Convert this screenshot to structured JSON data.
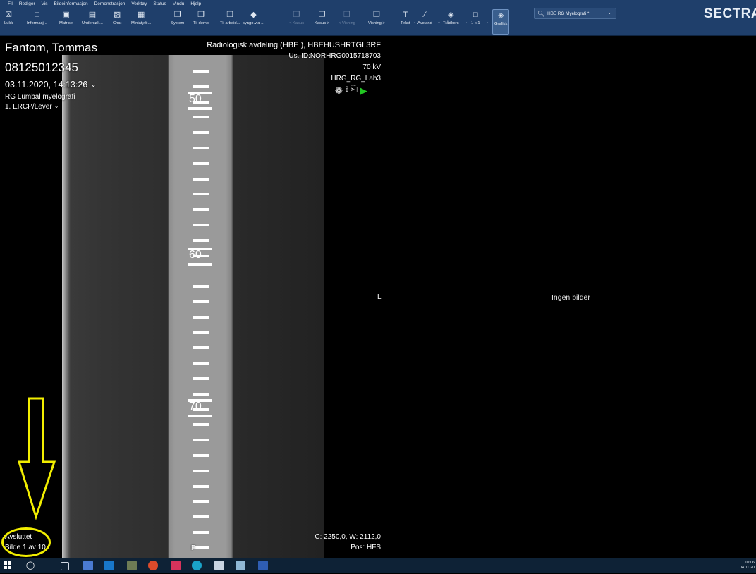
{
  "menu": [
    "Fil",
    "Rediger",
    "Vis",
    "Bildeinformasjon",
    "Demonstrasjon",
    "Verktøy",
    "Status",
    "Vindu",
    "Hjelp"
  ],
  "toolbar": {
    "buttons": [
      {
        "label": "Lukk",
        "icon": "close-icon"
      },
      {
        "label": "Informasj...",
        "icon": "info-icon"
      },
      {
        "label": "Matrise",
        "icon": "matrix-icon"
      },
      {
        "label": "Undersøk...",
        "icon": "examination-icon"
      },
      {
        "label": "Chat",
        "icon": "chat-icon"
      },
      {
        "label": "Miniatyrb...",
        "icon": "thumbnail-icon"
      },
      {
        "label": "System",
        "icon": "system-icon"
      },
      {
        "label": "Til demo",
        "icon": "demo-icon"
      },
      {
        "label": "Til arbeid...",
        "icon": "work-icon"
      },
      {
        "label": "syngo.via ...",
        "icon": "syngo-icon"
      },
      {
        "label": "< Kasus",
        "icon": "prev-case-icon"
      },
      {
        "label": "Kasus >",
        "icon": "next-case-icon"
      },
      {
        "label": "< Visning",
        "icon": "prev-view-icon"
      },
      {
        "label": "Visning >",
        "icon": "next-view-icon"
      },
      {
        "label": "Tekst",
        "icon": "text-tool-icon"
      },
      {
        "label": "Avstand",
        "icon": "distance-tool-icon"
      },
      {
        "label": "Trådkors",
        "icon": "crosshair-icon"
      },
      {
        "label": "1 x 1",
        "icon": "layout-1x1-icon"
      },
      {
        "label": "Grafikk",
        "icon": "graphics-icon"
      }
    ],
    "layout_select": "HBE RG Myelografi *",
    "brand": "SECTRA"
  },
  "left_view": {
    "patient_name": "Fantom, Tommas",
    "patient_id": "08125012345",
    "study_datetime": "03.11.2020, 14:13:26",
    "study_description": "RG Lumbal myelografi",
    "series": "1. ERCP/Lever",
    "institution": "Radiologisk avdeling (HBE ), HBEHUSHRTGL3RF",
    "accession": "Us. ID:NORHRG0015718703",
    "kv": "70 kV",
    "station": "HRG_RG_Lab3",
    "ruler_labels": [
      "50",
      "60",
      "70"
    ],
    "orientation_left": "L",
    "orientation_bottom": "F",
    "status": "Avsluttet",
    "image_counter": "Bilde 1 av 10",
    "window_level": "C: 2250,0, W: 2112,0",
    "position": "Pos: HFS"
  },
  "right_view": {
    "empty_message": "Ingen bilder"
  },
  "taskbar": {
    "time": "10:06",
    "date": "04.11.20"
  },
  "colors": {
    "toolbar_bg": "#1f3f6b",
    "annotation_yellow": "#f2ee00",
    "play_green": "#22c622"
  }
}
